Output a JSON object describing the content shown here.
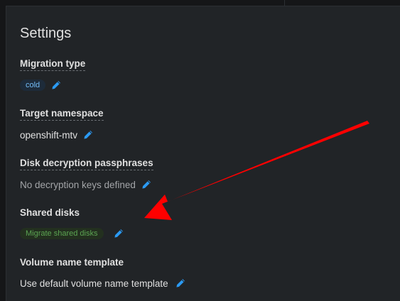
{
  "settings": {
    "title": "Settings",
    "migration_type": {
      "term": "Migration type",
      "value": "cold"
    },
    "target_namespace": {
      "term": "Target namespace",
      "value": "openshift-mtv"
    },
    "disk_decryption": {
      "term": "Disk decryption passphrases",
      "value": "No decryption keys defined"
    },
    "shared_disks": {
      "term": "Shared disks",
      "value": "Migrate shared disks"
    },
    "volume_name_template": {
      "term": "Volume name template",
      "value": "Use default volume name template"
    }
  },
  "colors": {
    "accent": "#2b9af3",
    "annotation_arrow": "#ff0000"
  },
  "icons": {
    "edit": "pencil-icon"
  }
}
